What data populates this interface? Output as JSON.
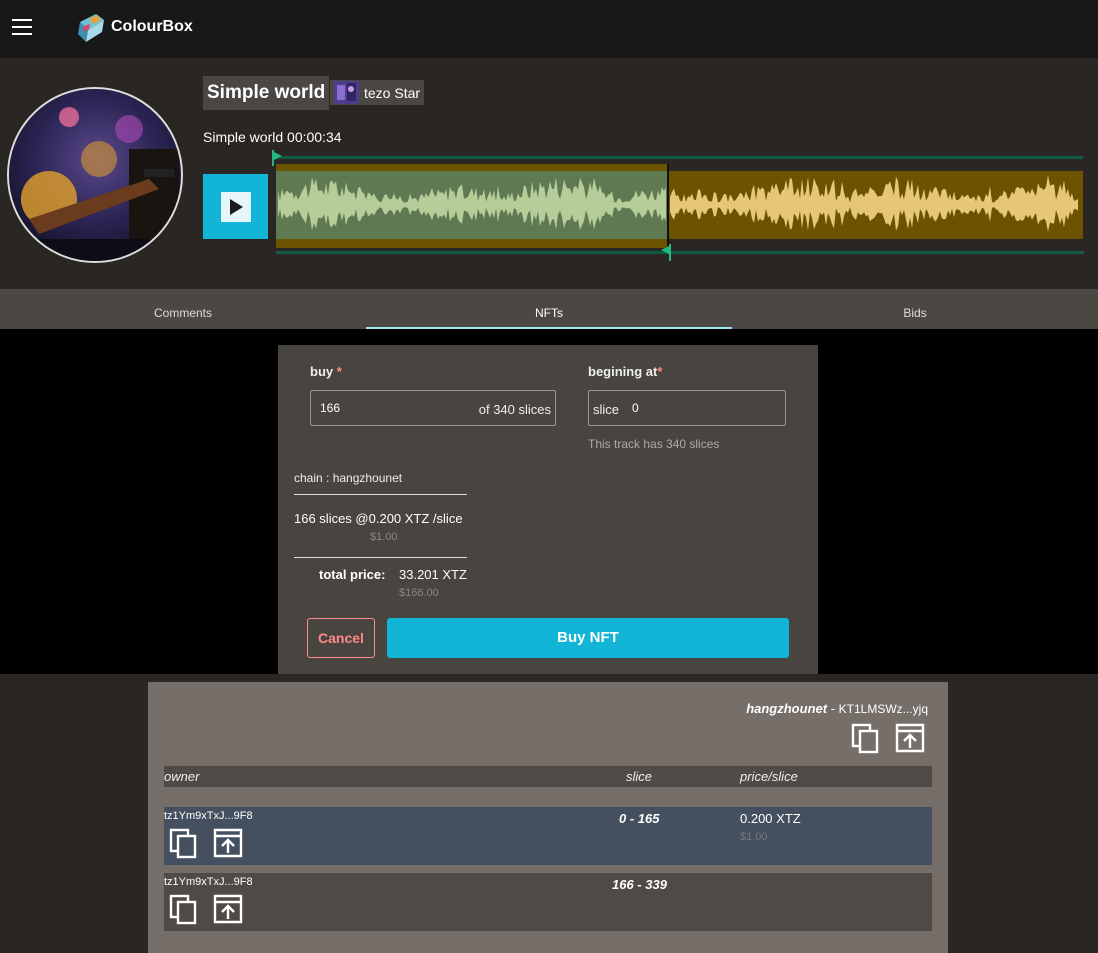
{
  "header": {
    "app_name": "ColourBox",
    "menu_icon": "hamburger-menu-icon"
  },
  "player": {
    "title": "Simple world",
    "artist": "tezo Star",
    "track_label": "Simple world 00:00:34",
    "play_icon": "play-icon",
    "selection_fraction": 0.488,
    "colors": {
      "selected": "#5f7a52",
      "unselected": "#6b5300",
      "accent": "#13b5d6"
    }
  },
  "tabs": [
    {
      "label": "Comments"
    },
    {
      "label": "NFTs"
    },
    {
      "label": "Bids"
    }
  ],
  "buy_form": {
    "buy_label": "buy",
    "required_mark": "*",
    "buy_value": "166",
    "buy_suffix": "of 340 slices",
    "begin_label": "begining at",
    "begin_prefix": "slice",
    "begin_value": "0",
    "begin_hint": "This track has 340 slices",
    "chain": "chain : hangzhounet",
    "slices_summary": "166 slices @0.200 XTZ /slice",
    "slices_usd": "$1.00",
    "total_label": "total price:",
    "total_value": "33.201 XTZ",
    "total_usd": "$166.00",
    "cancel_label": "Cancel",
    "buy_button": "Buy NFT"
  },
  "nft_list": {
    "network": "hangzhounet",
    "separator": " - ",
    "contract": "KT1LMSWz...yjq",
    "columns": {
      "owner": "owner",
      "slice": "slice",
      "price": "price/slice"
    },
    "rows": [
      {
        "owner": "tz1Ym9xTxJ...9F8",
        "slice": "0 - 165",
        "price": "0.200 XTZ",
        "usd": "$1.00"
      },
      {
        "owner": "tz1Ym9xTxJ...9F8",
        "slice": "166 - 339",
        "price": "",
        "usd": ""
      }
    ]
  }
}
